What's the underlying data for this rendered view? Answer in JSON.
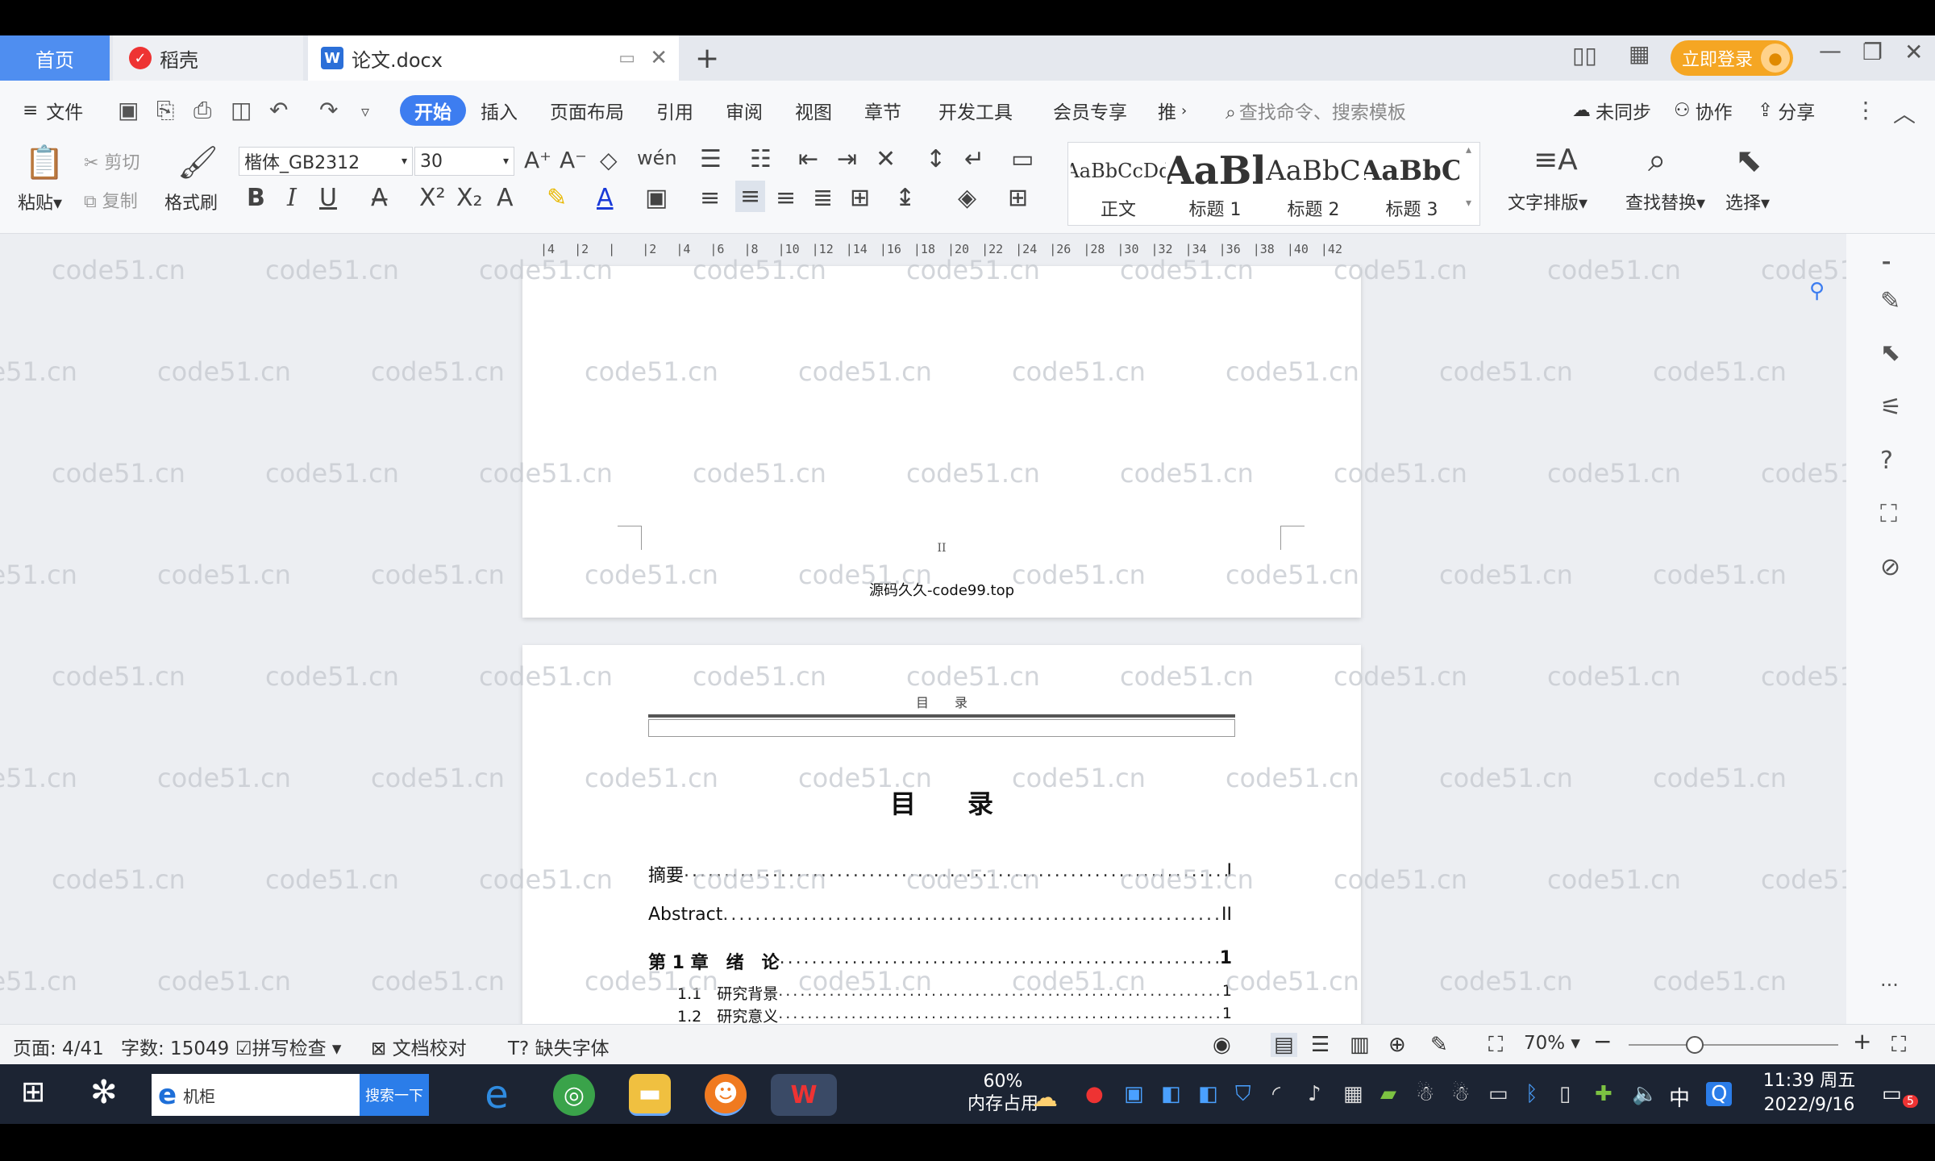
{
  "tabs": {
    "home": "首页",
    "docer": "稻壳",
    "document": "论文.docx",
    "login": "立即登录"
  },
  "menu": {
    "file": "文件",
    "start": "开始",
    "insert": "插入",
    "layout": "页面布局",
    "reference": "引用",
    "review": "审阅",
    "view": "视图",
    "chapter": "章节",
    "devtools": "开发工具",
    "member": "会员专享",
    "more": "推",
    "search_placeholder": "查找命令、搜索模板",
    "unsynced": "未同步",
    "collaborate": "协作",
    "share": "分享"
  },
  "ribbon": {
    "paste": "粘贴",
    "cut": "剪切",
    "copy": "复制",
    "format_painter": "格式刷",
    "font_name": "楷体_GB2312",
    "font_size": "30",
    "styles": [
      {
        "sample": "AaBbCcDd",
        "label": "正文"
      },
      {
        "sample": "AaBl",
        "label": "标题 1"
      },
      {
        "sample": "AaBbC",
        "label": "标题 2"
      },
      {
        "sample": "AaBbC",
        "label": "标题 3"
      }
    ],
    "text_layout": "文字排版",
    "find_replace": "查找替换",
    "select": "选择"
  },
  "ruler": {
    "ticks": [
      "4",
      "2",
      "",
      "2",
      "4",
      "6",
      "8",
      "10",
      "12",
      "14",
      "16",
      "18",
      "20",
      "22",
      "24",
      "26",
      "28",
      "30",
      "32",
      "34",
      "36",
      "38",
      "40",
      "42"
    ]
  },
  "document": {
    "page1_number": "II",
    "page1_footer": "源码久久-code99.top",
    "page2_header": "目　　录",
    "toc_title": "目　　录",
    "toc": [
      {
        "title": "摘要",
        "page": "I"
      },
      {
        "title": "Abstract",
        "page": "II"
      },
      {
        "title": "第 1 章　绪　论",
        "page": "1"
      },
      {
        "title": "1.1　研究背景",
        "page": "1"
      },
      {
        "title": "1.2　研究意义",
        "page": "1"
      }
    ],
    "watermark": "code51.cn"
  },
  "status": {
    "page": "页面: 4/41",
    "words": "字数: 15049",
    "spell": "拼写检查",
    "proof": "文档校对",
    "missing_font": "缺失字体",
    "zoom": "70%",
    "zoom_level_percent": 70
  },
  "taskbar": {
    "search_text": "机柜",
    "search_button": "搜索一下",
    "memory_percent": "60%",
    "memory_label": "内存占用",
    "ime": "中",
    "time": "11:39 周五",
    "date": "2022/9/16",
    "notification_count": "5"
  }
}
